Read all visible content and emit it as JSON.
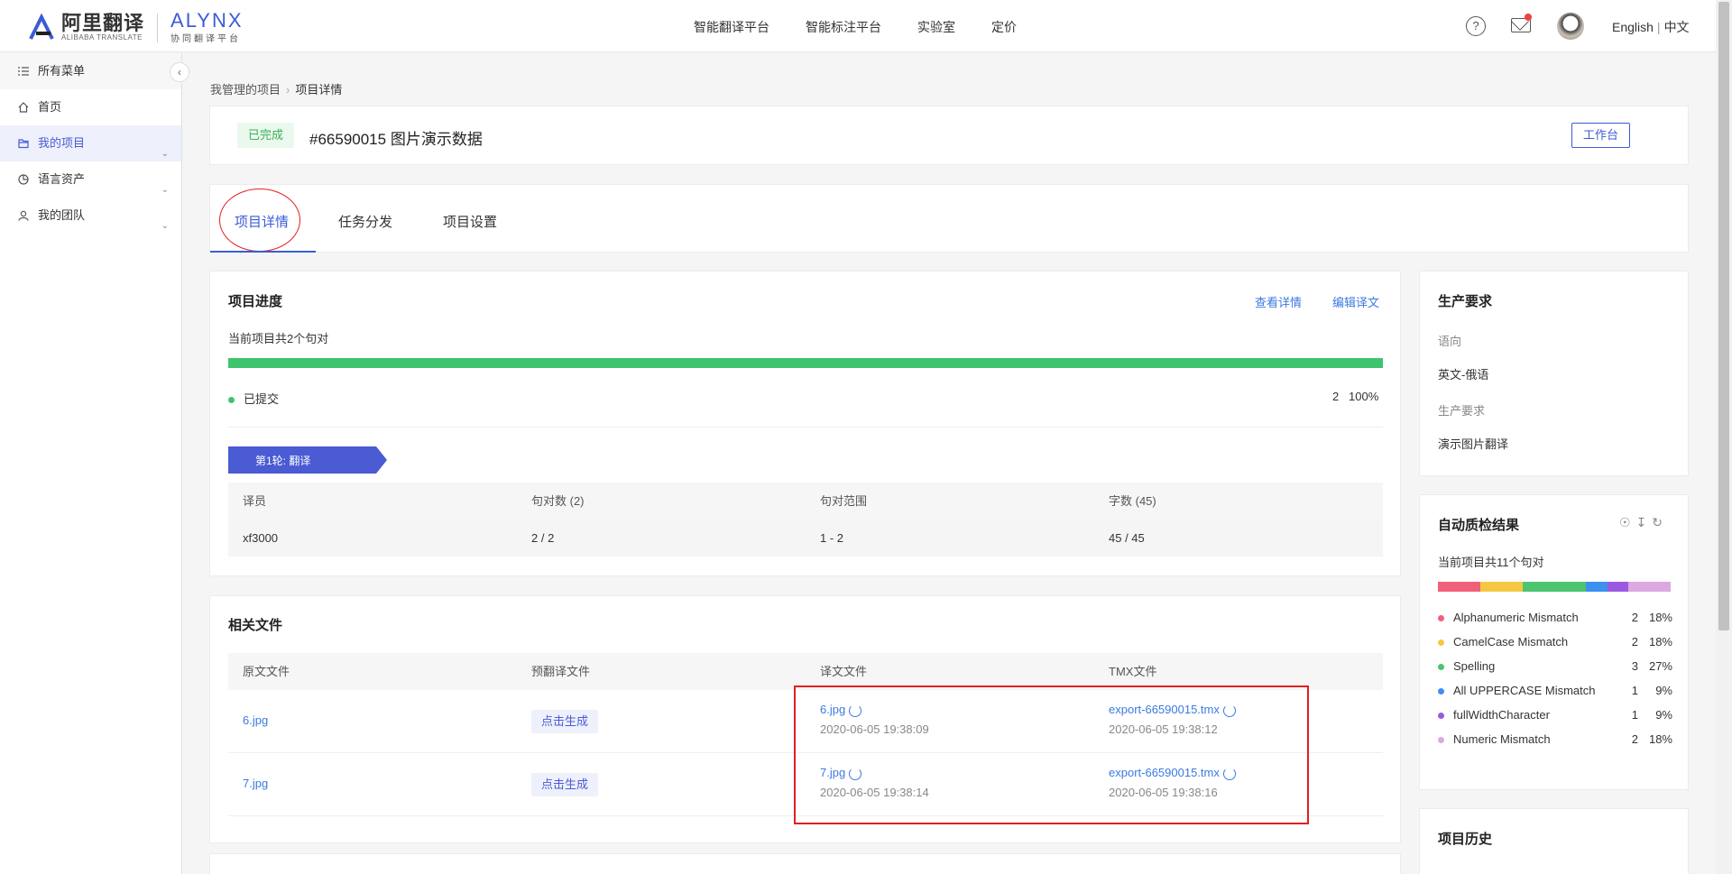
{
  "header": {
    "logo_cn": "阿里翻译",
    "logo_en": "ALIBABA TRANSLATE",
    "logo2_main": "ALYNX",
    "logo2_sub": "协同翻译平台",
    "nav": [
      "智能翻译平台",
      "智能标注平台",
      "实验室",
      "定价"
    ],
    "help_icon": "?",
    "lang_en": "English",
    "lang_sep": "|",
    "lang_cn": "中文"
  },
  "sidebar": {
    "items": [
      {
        "label": "所有菜单",
        "icon": "menu-list-icon"
      },
      {
        "label": "首页",
        "icon": "home-icon"
      },
      {
        "label": "我的项目",
        "icon": "folder-icon"
      },
      {
        "label": "语言资产",
        "icon": "pie-chart-icon"
      },
      {
        "label": "我的团队",
        "icon": "user-icon"
      }
    ]
  },
  "breadcrumb": {
    "parent": "我管理的项目",
    "current": "项目详情"
  },
  "project": {
    "status": "已完成",
    "title": "#66590015 图片演示数据",
    "workbench": "工作台"
  },
  "tabs": [
    "项目详情",
    "任务分发",
    "项目设置"
  ],
  "progress": {
    "title": "项目进度",
    "view_detail": "查看详情",
    "edit_translation": "编辑译文",
    "summary": "当前项目共2个句对",
    "percent": 100,
    "status_label": "已提交",
    "status_count": "2",
    "status_pct": "100%",
    "round_label": "第1轮: 翻译",
    "columns": [
      "译员",
      "句对数 (2)",
      "句对范围",
      "字数 (45)"
    ],
    "rows": [
      [
        "xf3000",
        "2 / 2",
        "1 - 2",
        "45 / 45"
      ]
    ]
  },
  "files": {
    "title": "相关文件",
    "columns": [
      "原文文件",
      "预翻译文件",
      "译文文件",
      "TMX文件"
    ],
    "rows": [
      {
        "source": "6.jpg",
        "pretrans": "点击生成",
        "target": "6.jpg",
        "target_time": "2020-06-05 19:38:09",
        "tmx": "export-66590015.tmx",
        "tmx_time": "2020-06-05 19:38:12"
      },
      {
        "source": "7.jpg",
        "pretrans": "点击生成",
        "target": "7.jpg",
        "target_time": "2020-06-05 19:38:14",
        "tmx": "export-66590015.tmx",
        "tmx_time": "2020-06-05 19:38:16"
      }
    ]
  },
  "requirements": {
    "title": "生产要求",
    "direction_label": "语向",
    "direction": "英文-俄语",
    "req_label": "生产要求",
    "req": "演示图片翻译"
  },
  "qc": {
    "title": "自动质检结果",
    "summary": "当前项目共11个句对",
    "items": [
      {
        "label": "Alphanumeric Mismatch",
        "count": "2",
        "pct": "18%",
        "color": "#f0607a",
        "share": 18
      },
      {
        "label": "CamelCase Mismatch",
        "count": "2",
        "pct": "18%",
        "color": "#f5c842",
        "share": 18
      },
      {
        "label": "Spelling",
        "count": "3",
        "pct": "27%",
        "color": "#4cc470",
        "share": 27
      },
      {
        "label": "All UPPERCASE Mismatch",
        "count": "1",
        "pct": "9%",
        "color": "#3d8ff0",
        "share": 9
      },
      {
        "label": "fullWidthCharacter",
        "count": "1",
        "pct": "9%",
        "color": "#9a5ae0",
        "share": 9
      },
      {
        "label": "Numeric Mismatch",
        "count": "2",
        "pct": "18%",
        "color": "#dba8e0",
        "share": 18
      }
    ]
  },
  "history": {
    "title": "项目历史"
  }
}
